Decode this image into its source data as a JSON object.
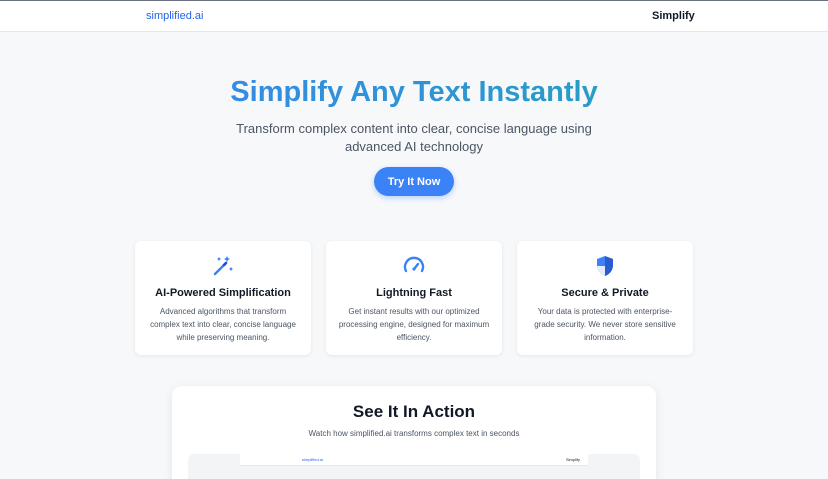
{
  "header": {
    "brand": "simplified.ai",
    "nav_link": "Simplify"
  },
  "hero": {
    "title": "Simplify Any Text Instantly",
    "subtitle": "Transform complex content into clear, concise language using advanced AI technology",
    "cta_label": "Try It Now"
  },
  "features": [
    {
      "icon": "magic-wand-icon",
      "title": "AI-Powered Simplification",
      "description": "Advanced algorithms that transform complex text into clear, concise language while preserving meaning."
    },
    {
      "icon": "speedometer-icon",
      "title": "Lightning Fast",
      "description": "Get instant results with our optimized processing engine, designed for maximum efficiency."
    },
    {
      "icon": "shield-icon",
      "title": "Secure & Private",
      "description": "Your data is protected with enterprise-grade security. We never store sensitive information."
    }
  ],
  "demo": {
    "title": "See It In Action",
    "subtitle": "Watch how simplified.ai transforms complex text in seconds",
    "preview_brand": "simplified.ai",
    "preview_link": "Simplify"
  },
  "colors": {
    "accent": "#3b82f6",
    "gradient_end": "#22a6b3",
    "brand_text": "#2563eb"
  }
}
